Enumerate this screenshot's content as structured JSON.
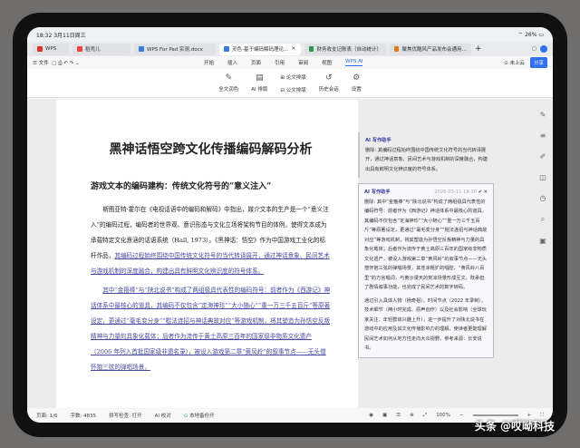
{
  "status_bar": {
    "time": "18:32",
    "date": "3月11日周三",
    "battery": "26%"
  },
  "tabs": [
    {
      "label": "WPS",
      "color": "#d33"
    },
    {
      "label": "稻壳儿",
      "color": "#e44"
    },
    {
      "label": "WPS For Pad 实测.docx",
      "color": "#3a7be0"
    },
    {
      "label": "灵色-基于编码解码理论…",
      "color": "#3a7be0",
      "active": true
    },
    {
      "label": "财务收支记账表（自动统计）",
      "color": "#2a9a4a"
    },
    {
      "label": "聚焦优酷风产品发布会通用…",
      "color": "#e07a20"
    }
  ],
  "menu": {
    "file": "文件",
    "items": [
      "开始",
      "插入",
      "页面",
      "引用",
      "审阅",
      "视图",
      "WPS AI"
    ],
    "cloud": "未上云",
    "share": "分享"
  },
  "ribbon": {
    "items": [
      "全文润色",
      "AI 排版",
      "论文排版",
      "公文排版",
      "历史会话",
      "设置"
    ]
  },
  "doc": {
    "title": "黑神话悟空跨文化传播编码解码分析",
    "heading": "游戏文本的编码建构：传统文化符号的“意义注入”",
    "p1_plain": "斯图亚特·霍尔在《电视话语中的编码和解码》中指出，媒介文本的生产是一个“意义注入”的编码过程，编码者的世界观、意识形态与文化立场将架构节目的体例，使得文本成为承载特定文化意涵的话语系统（Hall, 1973）。《黑神话：悟空》作为中国游戏工业化的标杆作品，",
    "p1_marked": "其编码过程始终围绕中国传统文化符号的当代转译展开，通过神话意象、民间艺术与游戏机制的深度融合，构建出具有鲜明文化辨识度的符号体系。",
    "p2_marked": "其中“金箍棒”与“陕北说书”构成了两组极具代表性的编码符号：前者作为《西游记》神话体系中最核心的道具，其编码不仅包含“定海神珍”“大小随心”“重一万三千五百斤”等原著设定，更通过“毫毛变分身”“棍法连招与神话典故对应”等游戏机制，将其塑造为孙悟空反叛精神与力量的具象化载体；后者作为流传于黄土高原三百年的国家级非物质文化遗产（2006 年列入首批国家级非遗名录），被设入游戏第二章“黄风岭”的叙事节点——无头僧怀抱三弦的弹唱场景，"
  },
  "comments": [
    {
      "author": "AI 写作助手",
      "text": "删除: 其编码过程始终围绕中国传统文化符号的当代转译展开，通过神话意象、民间艺术与游戏机制的深度融合，构建出具有鲜明文化辨识度的符号体系。"
    },
    {
      "author": "AI 写作助手",
      "time": "2026-03-11 18:30",
      "text": "删除: 其中“金箍棒”与“陕北说书”构成了两组极具代表性的编码符号：前者作为《西游记》神话体系中最核心的道具，其编码不仅包含“定海神珍”“大小随心”“重一万三千五百斤”等原著设定，更通过“毫毛变分身”“棍法连招与神话典故对应”等游戏机制，将其塑造为孙悟空反叛精神与力量的具象化载体；后者作为流传于黄土高原三百年的国家级非物质文化遗产，被设入游戏第二章“黄风岭”的叙事节点——无头僧怀抱三弦的弹唱场景，其苍凉粗犷的唱腔、“黄风岭八百里”的方言唱词，与黄沙漫天的荒凉场景形成互文，既承担了剧情叙事功能，也完成了民间艺术的数字转码。",
      "extra": "通过引入具体人物（杨奇祖）、时间节点（2022 年录制）、技术细节（两小时完成、原声创作）以及社会影响（全球玩家关注、年轻群体兴趣上升），进一步提升了对陕北说书在游戏中的应用及其文化传播影响力的理解，使读者更能理解民间艺术如何从地方性走向大众视野。参考来源：长安说书。"
    }
  ],
  "status": {
    "page": "页面: 1/6",
    "words": "字数: 4835",
    "spell": "拼写检查: 打开",
    "ai": "AI 校对",
    "save": "本地备份开",
    "zoom": "100%"
  },
  "watermark": "头条 @哎呦科技"
}
